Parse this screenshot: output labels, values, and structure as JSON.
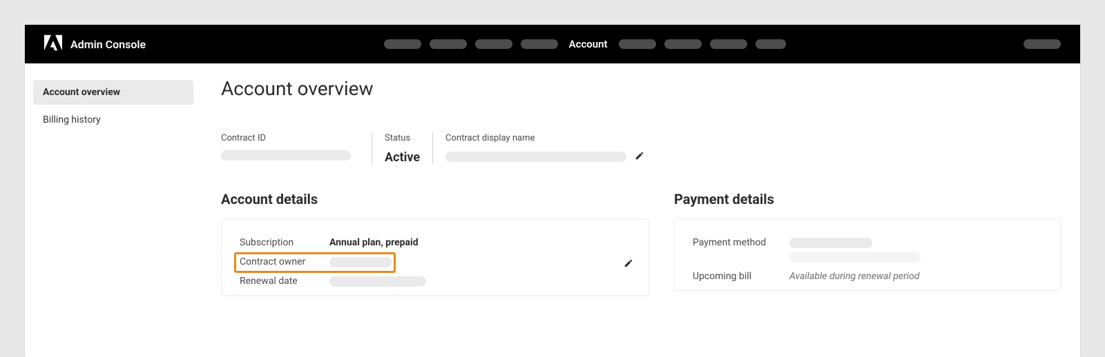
{
  "header": {
    "app_name": "Admin Console",
    "active_tab": "Account"
  },
  "sidebar": {
    "items": [
      {
        "label": "Account overview",
        "active": true
      },
      {
        "label": "Billing history",
        "active": false
      }
    ]
  },
  "page": {
    "title": "Account overview",
    "contract_id_label": "Contract ID",
    "status_label": "Status",
    "status_value": "Active",
    "display_name_label": "Contract display name"
  },
  "account_details": {
    "heading": "Account details",
    "subscription_label": "Subscription",
    "subscription_value": "Annual plan, prepaid",
    "contract_owner_label": "Contract owner",
    "renewal_date_label": "Renewal date"
  },
  "payment_details": {
    "heading": "Payment details",
    "payment_method_label": "Payment method",
    "upcoming_bill_label": "Upcoming bill",
    "upcoming_bill_value": "Available during renewal period"
  }
}
